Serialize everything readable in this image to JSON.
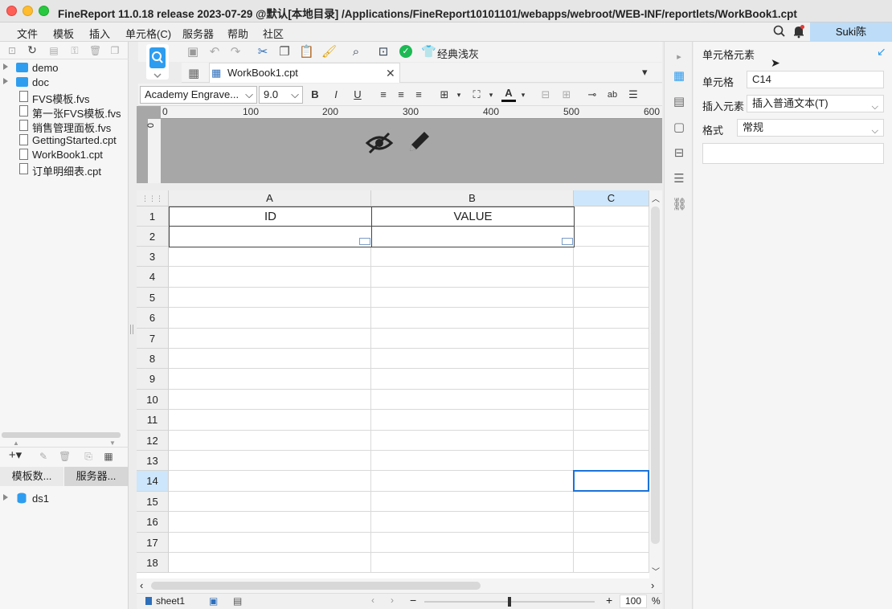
{
  "window": {
    "title": "FineReport 11.0.18 release 2023-07-29 @默认[本地目录]  /Applications/FineReport10101101/webapps/webroot/WEB-INF/reportlets/WorkBook1.cpt"
  },
  "menu": {
    "items": [
      "文件",
      "模板",
      "插入",
      "单元格(C)",
      "服务器",
      "帮助",
      "社区"
    ],
    "user": "Suki陈"
  },
  "tree": {
    "items": [
      {
        "label": "demo",
        "kind": "folder"
      },
      {
        "label": "doc",
        "kind": "folder"
      },
      {
        "label": "FVS模板.fvs",
        "kind": "file"
      },
      {
        "label": "第一张FVS模板.fvs",
        "kind": "file"
      },
      {
        "label": "销售管理面板.fvs",
        "kind": "file"
      },
      {
        "label": "GettingStarted.cpt",
        "kind": "file"
      },
      {
        "label": "WorkBook1.cpt",
        "kind": "file"
      },
      {
        "label": "订单明细表.cpt",
        "kind": "file"
      }
    ]
  },
  "datasource": {
    "tabs": [
      "模板数...",
      "服务器..."
    ],
    "items": [
      "ds1"
    ]
  },
  "toolbar": {
    "theme_label": "经典浅灰"
  },
  "editor": {
    "tab_label": "WorkBook1.cpt",
    "font_name": "Academy Engrave...",
    "font_size": "9.0"
  },
  "ruler": {
    "ticks": [
      "0",
      "100",
      "200",
      "300",
      "400",
      "500",
      "600"
    ],
    "vertical_zero": "0"
  },
  "sheet": {
    "columns": [
      "A",
      "B",
      "C"
    ],
    "rows": [
      "1",
      "2",
      "3",
      "4",
      "5",
      "6",
      "7",
      "8",
      "9",
      "10",
      "11",
      "12",
      "13",
      "14",
      "15",
      "16",
      "17",
      "18"
    ],
    "header_cells": [
      "ID",
      "VALUE"
    ],
    "selected_cell": "C14"
  },
  "status": {
    "sheet_tab": "sheet1",
    "zoom": "100",
    "zoom_unit": "%"
  },
  "cell_panel": {
    "title": "单元格元素",
    "cell_label": "单元格",
    "cell_value": "C14",
    "insert_label": "插入元素",
    "insert_value": "插入普通文本(T)",
    "format_label": "格式",
    "format_value": "常规"
  },
  "colors": {
    "accent": "#2e9df0",
    "selection": "#1a73d9",
    "user_badge": "#bcdcf7"
  }
}
